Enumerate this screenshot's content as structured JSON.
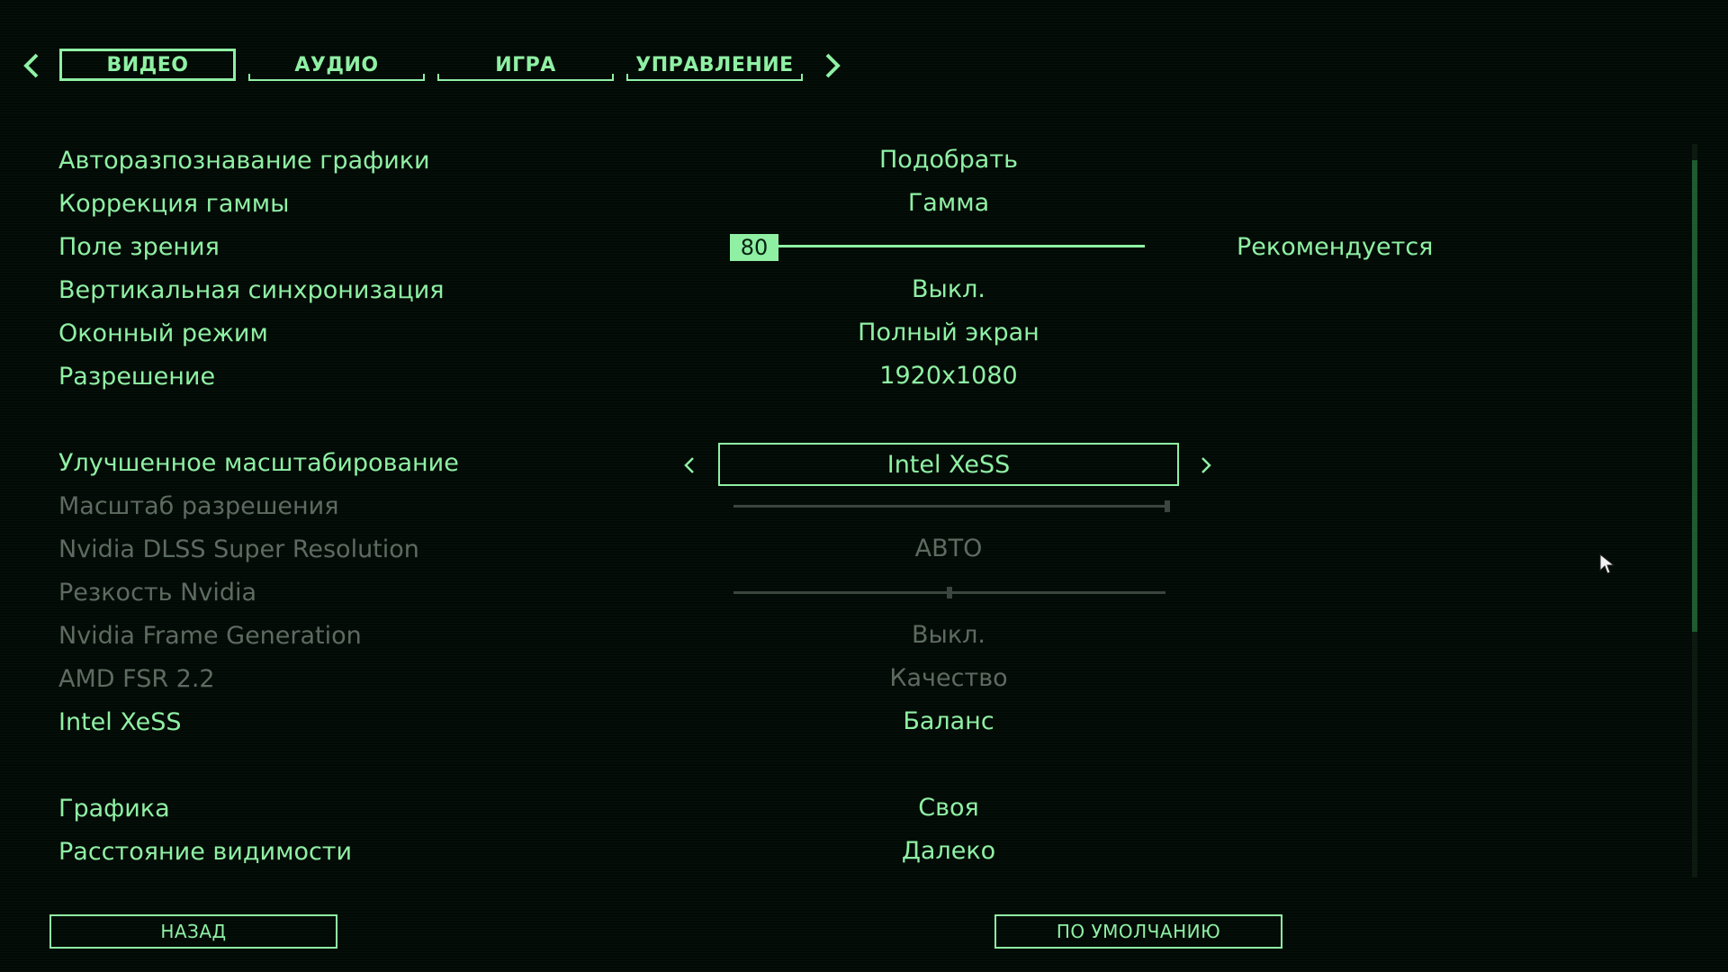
{
  "tabs": [
    {
      "label": "ВИДЕО",
      "active": true
    },
    {
      "label": "АУДИО",
      "active": false
    },
    {
      "label": "ИГРА",
      "active": false
    },
    {
      "label": "УПРАВЛЕНИЕ",
      "active": false
    }
  ],
  "settings": [
    {
      "label": "Авторазпознавание графики",
      "value": "Подобрать"
    },
    {
      "label": "Коррекция гаммы",
      "value": "Гамма"
    },
    {
      "label": "Поле зрения",
      "value": "80",
      "note": "Рекомендуется",
      "slider_fraction": 0.0
    },
    {
      "label": "Вертикальная синхронизация",
      "value": "Выкл."
    },
    {
      "label": "Оконный режим",
      "value": "Полный экран"
    },
    {
      "label": "Разрешение",
      "value": "1920x1080"
    },
    {
      "label": "Улучшенное масштабирование",
      "value": "Intel XeSS"
    },
    {
      "label": "Масштаб разрешения",
      "slider_fraction": 1.0,
      "disabled": true
    },
    {
      "label": "Nvidia DLSS Super Resolution",
      "value": "АВТО",
      "disabled": true
    },
    {
      "label": "Резкость Nvidia",
      "slider_fraction": 0.5,
      "disabled": true
    },
    {
      "label": "Nvidia Frame Generation",
      "value": "Выкл.",
      "disabled": true
    },
    {
      "label": "AMD FSR 2.2",
      "value": "Качество",
      "disabled": true
    },
    {
      "label": "Intel XeSS",
      "value": "Баланс"
    },
    {
      "label": "Графика",
      "value": "Своя"
    },
    {
      "label": "Расстояние видимости",
      "value": "Далеко"
    }
  ],
  "buttons": {
    "back": "НАЗАД",
    "defaults": "ПО УМОЛЧАНИЮ"
  },
  "colors": {
    "accent": "#8ff0a4",
    "disabled": "#5d6b61",
    "background": "#020a05"
  },
  "icons": {
    "prev_tab": "chevron-left-icon",
    "next_tab": "chevron-right-icon",
    "cursor": "mouse-cursor-icon"
  }
}
